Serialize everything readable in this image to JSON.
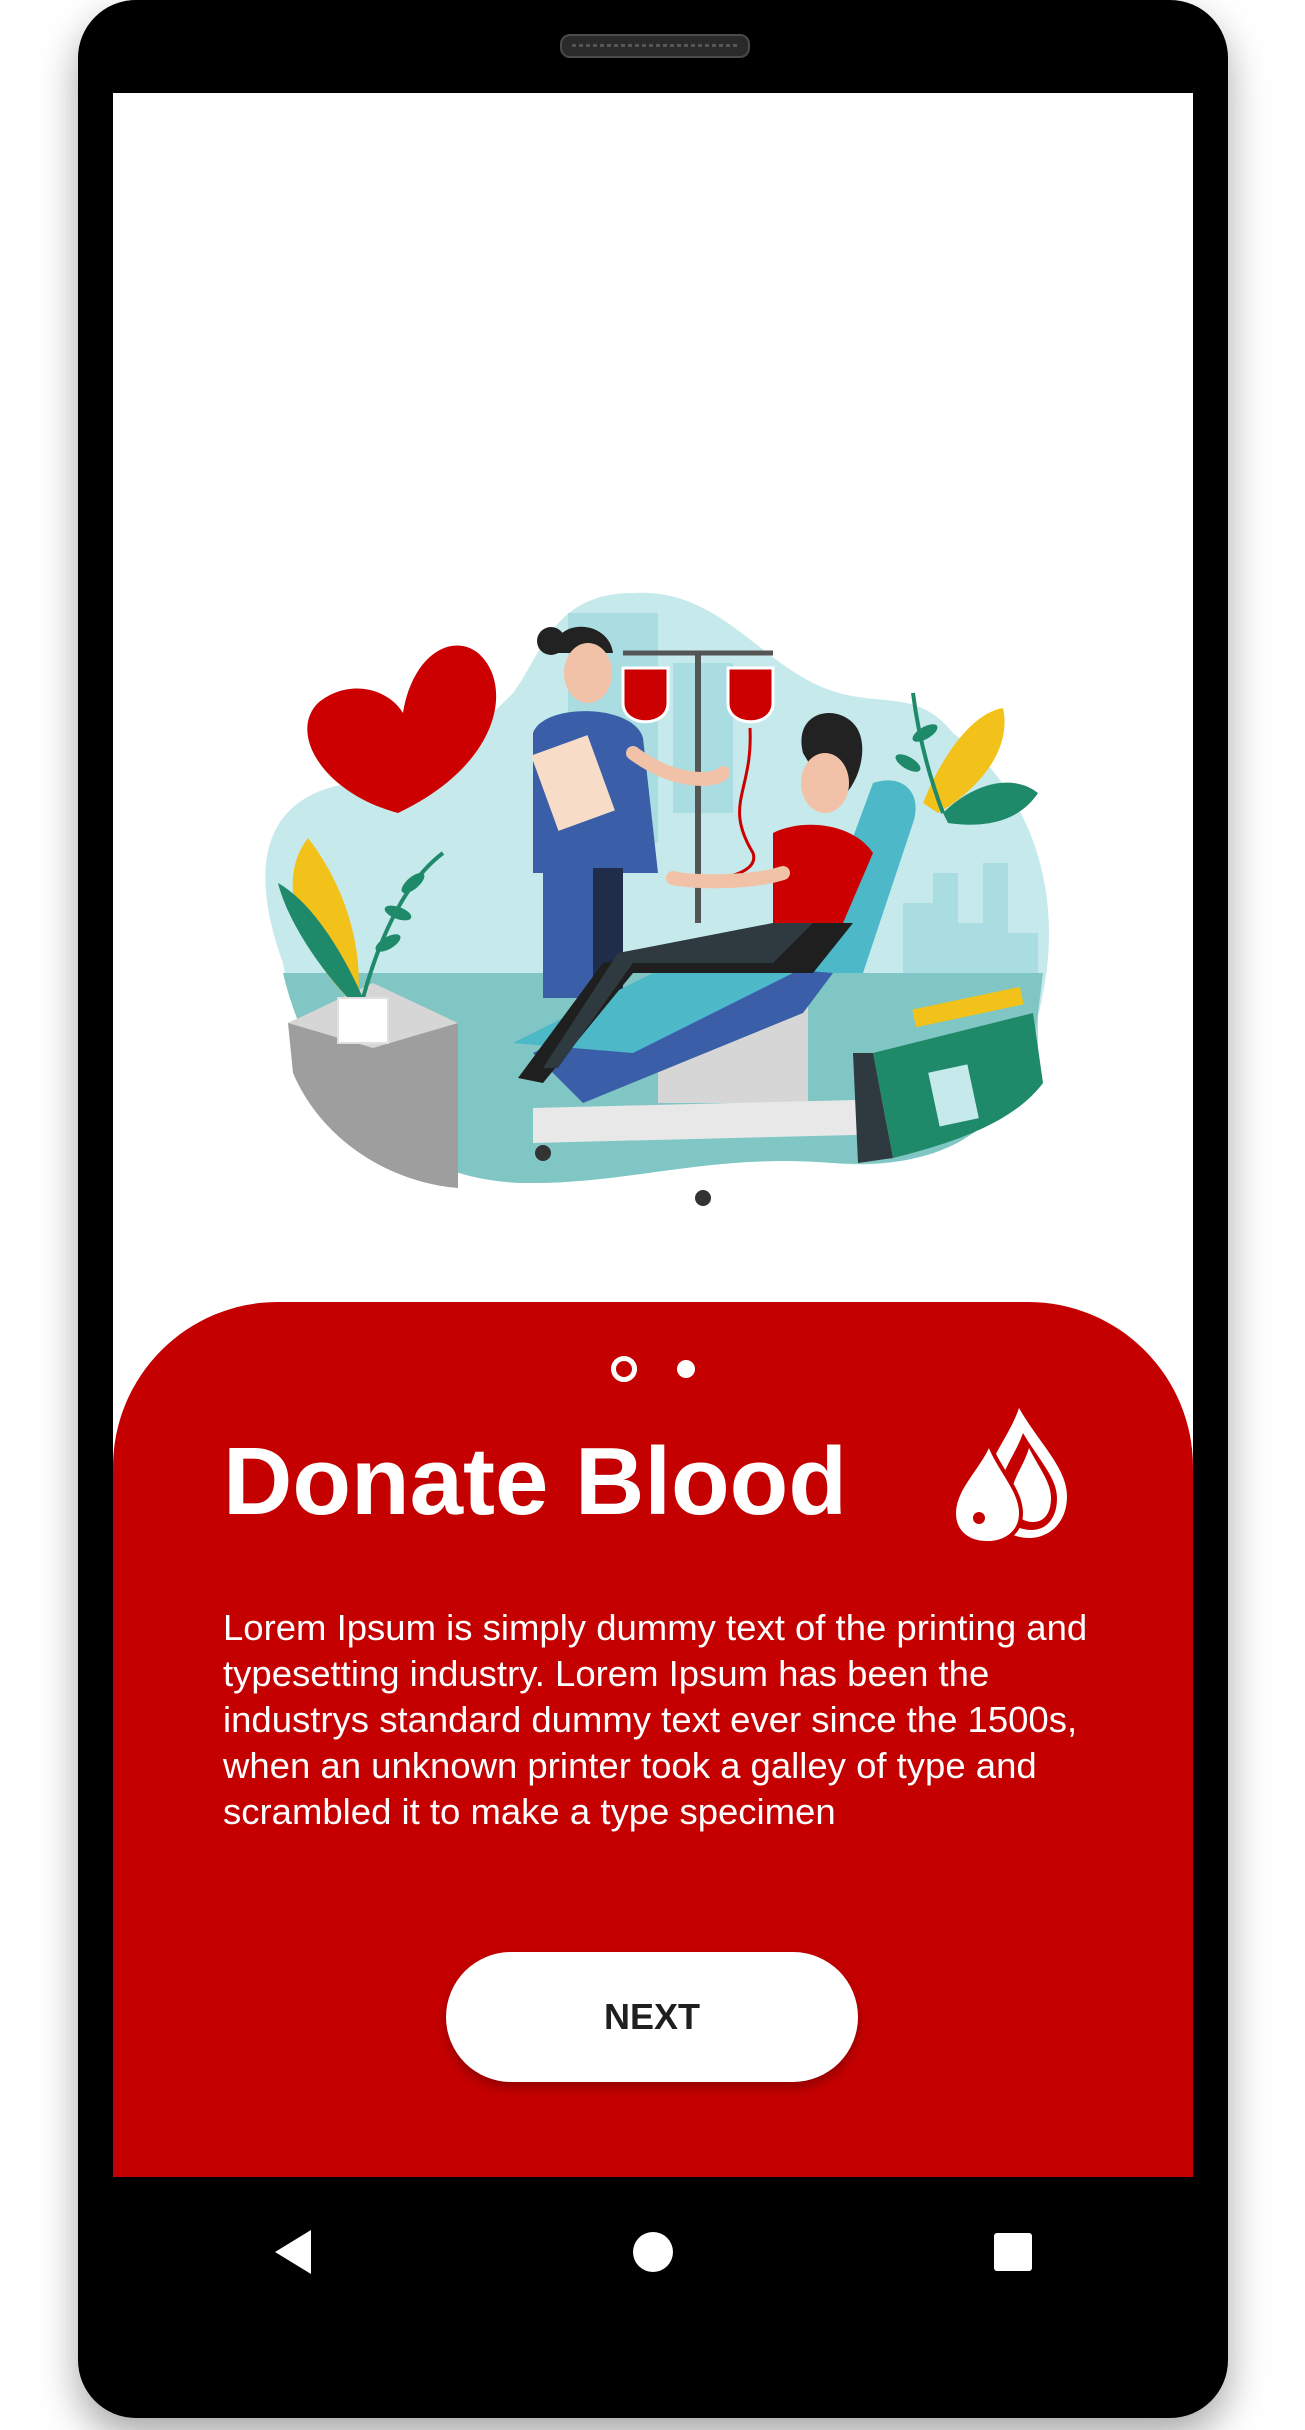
{
  "onboarding": {
    "title": "Donate Blood",
    "description": "Lorem Ipsum is simply dummy text of the printing and typesetting industry. Lorem Ipsum has been the industrys standard dummy text ever since the 1500s, when an unknown printer took a galley of type and scrambled it to make a type specimen",
    "next_label": "NEXT",
    "page_indicator": {
      "current": 1,
      "total": 2
    }
  },
  "icons": {
    "title_icon": "blood-drops-icon",
    "nav_back": "back-triangle-icon",
    "nav_home": "home-circle-icon",
    "nav_recents": "recents-square-icon"
  },
  "colors": {
    "accent": "#c40000",
    "heart": "#cc0000",
    "teal_light": "#c6e9ec",
    "chair_blue": "#3a5fa8",
    "chair_teal": "#4db8c8",
    "plant_yellow": "#f2c21b",
    "plant_green": "#1f8a6a"
  }
}
